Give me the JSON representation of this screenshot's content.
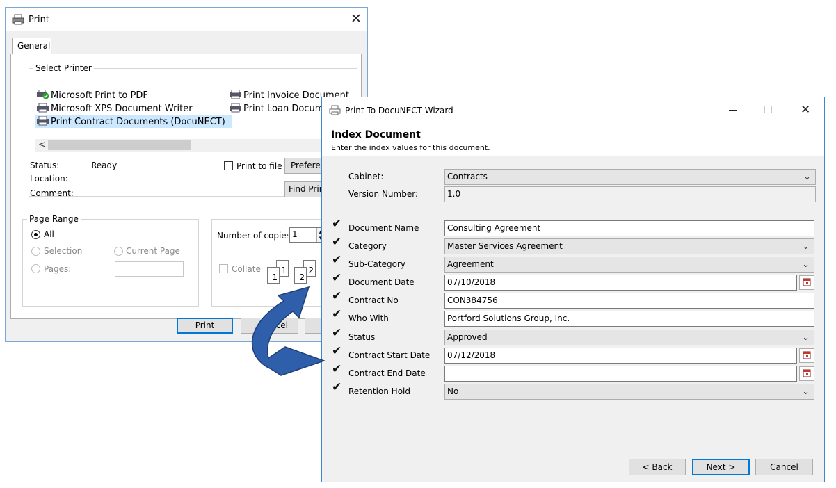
{
  "print_dialog": {
    "title": "Print",
    "tab": "General",
    "select_printer_label": "Select Printer",
    "printers": [
      "Microsoft Print to PDF",
      "Microsoft XPS Document Writer",
      "Print Contract Documents (DocuNECT)",
      "Print Invoice Document (",
      "Print Loan Document"
    ],
    "status_label": "Status:",
    "status_value": "Ready",
    "location_label": "Location:",
    "comment_label": "Comment:",
    "print_to_file": "Print to file",
    "preferences_button": "Preferen",
    "find_printer_button": "Find Print",
    "page_range_label": "Page Range",
    "range_all": "All",
    "range_selection": "Selection",
    "range_current_page": "Current Page",
    "range_pages": "Pages:",
    "copies_label": "Number of copies:",
    "copies_value": "1",
    "collate": "Collate",
    "print_button": "Print",
    "cancel_button": "ncel"
  },
  "wizard": {
    "title": "Print To DocuNECT Wizard",
    "header_title": "Index Document",
    "header_subtitle": "Enter the index values for this document.",
    "cabinet_label": "Cabinet:",
    "cabinet_value": "Contracts",
    "version_label": "Version Number:",
    "version_value": "1.0",
    "fields": [
      {
        "label": "Document Name",
        "value": "Consulting Agreement",
        "kind": "text"
      },
      {
        "label": "Category",
        "value": "Master Services Agreement",
        "kind": "combo"
      },
      {
        "label": "Sub-Category",
        "value": "Agreement",
        "kind": "combo"
      },
      {
        "label": "Document Date",
        "value": "07/10/2018",
        "kind": "date"
      },
      {
        "label": "Contract No",
        "value": "CON384756",
        "kind": "text"
      },
      {
        "label": "Who With",
        "value": "Portford Solutions Group, Inc.",
        "kind": "text"
      },
      {
        "label": "Status",
        "value": "Approved",
        "kind": "combo"
      },
      {
        "label": "Contract Start Date",
        "value": "07/12/2018",
        "kind": "date"
      },
      {
        "label": "Contract End Date",
        "value": "",
        "kind": "date"
      },
      {
        "label": "Retention Hold",
        "value": "No",
        "kind": "combo"
      }
    ],
    "back_button": "< Back",
    "next_button": "Next >",
    "cancel_button": "Cancel"
  },
  "colors": {
    "accent": "#0078d7",
    "selection": "#cce8ff",
    "arrow": "#2f5fab"
  }
}
